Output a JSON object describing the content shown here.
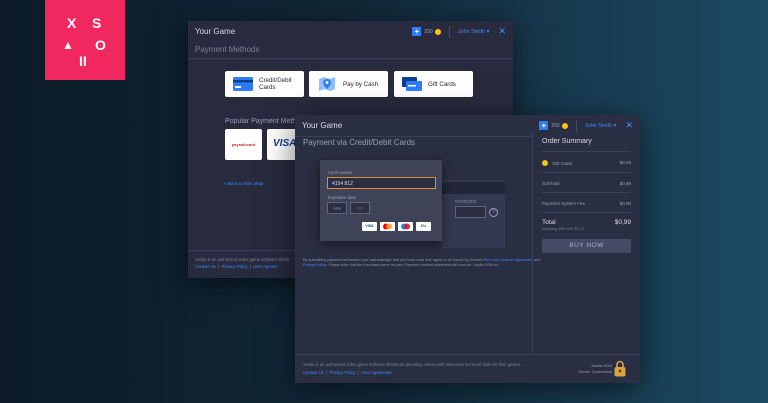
{
  "brand_logo": {
    "glyphs": [
      "X",
      "S",
      "▲",
      "O",
      "II"
    ],
    "color": "#f0285f"
  },
  "back_window": {
    "title": "Your Game",
    "coins_value": "250",
    "user": "John Smith",
    "heading": "Payment Methods",
    "methods": [
      {
        "label_line1": "Credit/Debit",
        "label_line2": "Cards",
        "icon": "credit-card-icon"
      },
      {
        "label_line1": "Pay by Cash",
        "label_line2": "",
        "icon": "map-pin-icon"
      },
      {
        "label_line1": "Gift Cards",
        "label_line2": "",
        "icon": "gift-cards-icon"
      }
    ],
    "popular_label": "Popular Payment Meth",
    "popular": [
      {
        "name": "paysafecard"
      },
      {
        "name": "VISA"
      }
    ],
    "back_link": "< Back to item shop",
    "footer_text": "Xsolla is an authorized video game software distrib",
    "footer_links": [
      "Contact Us",
      "Privacy Policy",
      "User Agreem"
    ]
  },
  "front_window": {
    "title": "Your Game",
    "coins_value": "250",
    "user": "John Smith",
    "heading": "Payment via Credit/Debit Cards",
    "card_number_label": "Card number",
    "card_number_value": "4154 812",
    "expiration_label": "Expiration date",
    "mm_placeholder": "MM",
    "yy_placeholder": "YY",
    "cvv_label": "CVV/CVC2",
    "brands": [
      "VISA",
      "MC",
      "Maestro",
      "Elo"
    ],
    "consent_text": "By submitting payment information you acknowledge that you have read and agree to be bound by Xsolla's",
    "consent_link1": "End User License Agreement",
    "consent_and": "and",
    "consent_link2": "Privacy Policy",
    "consent_rest": ". Please note that the merchant name on your Payment method statement will read as: Xsolla USA Inc.",
    "summary": {
      "title": "Order Summary",
      "item_label": "100 Coins",
      "item_price": "$0,99",
      "subtotal_label": "SubTotal",
      "subtotal": "$0,99",
      "fee_label": "Payment System Fee",
      "fee": "$0,00",
      "total_label": "Total",
      "total": "$0,99",
      "vat_note": "Including 18% VAT $0,17",
      "buy_label": "BUY NOW"
    },
    "footer_text": "Xsolla is an authorized video game software distributor providing clients with advanced technical tools for their games.",
    "footer_links": [
      "Contact Us",
      "Privacy Policy",
      "User Agreement"
    ],
    "secure_brand": "Xsolla 2016",
    "secure_text": "Secure Connection"
  }
}
